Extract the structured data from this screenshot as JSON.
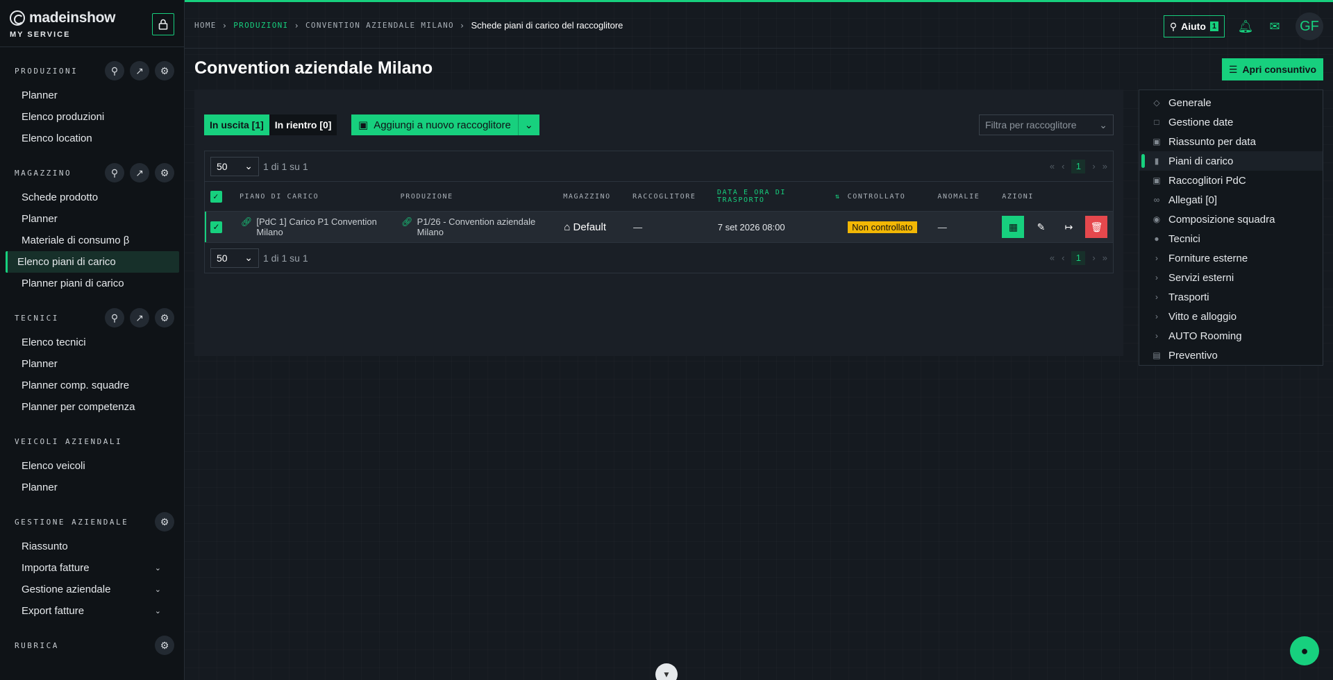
{
  "brand": {
    "name": "madeinshow",
    "sub": "MY SERVICE"
  },
  "sidebar": {
    "sections": [
      {
        "title": "PRODUZIONI",
        "items": [
          "Planner",
          "Elenco produzioni",
          "Elenco location"
        ]
      },
      {
        "title": "MAGAZZINO",
        "items": [
          "Schede prodotto",
          "Planner",
          "Materiale di consumo β",
          "Elenco piani di carico",
          "Planner piani di carico"
        ]
      },
      {
        "title": "TECNICI",
        "items": [
          "Elenco tecnici",
          "Planner",
          "Planner comp. squadre",
          "Planner per competenza"
        ]
      },
      {
        "title": "VEICOLI AZIENDALI",
        "items": [
          "Elenco veicoli",
          "Planner"
        ]
      },
      {
        "title": "GESTIONE AZIENDALE",
        "items": [
          "Riassunto",
          "Importa fatture",
          "Gestione aziendale",
          "Export fatture"
        ]
      },
      {
        "title": "RUBRICA",
        "items": []
      }
    ]
  },
  "breadcrumb": {
    "home": "HOME",
    "produzioni": "PRODUZIONI",
    "convention": "CONVENTION AZIENDALE MILANO",
    "current": "Schede piani di carico del raccoglitore"
  },
  "topbar": {
    "help_label": "Aiuto",
    "help_count": "1",
    "avatar": "GF"
  },
  "page": {
    "title": "Convention aziendale Milano",
    "open_button": "Apri consuntivo"
  },
  "toolbar": {
    "tab_out": "In uscita [1]",
    "tab_in": "In rientro [0]",
    "add_button": "Aggiungi a nuovo raccoglitore",
    "filter_placeholder": "Filtra per raccoglitore"
  },
  "pager": {
    "per_page": "50",
    "summary": "1 di 1 su 1",
    "page": "1"
  },
  "table": {
    "headers": {
      "piano": "PIANO DI CARICO",
      "produzione": "PRODUZIONE",
      "magazzino": "MAGAZZINO",
      "raccoglitore": "RACCOGLITORE",
      "data": "DATA E ORA DI TRASPORTO",
      "controllato": "CONTROLLATO",
      "anomalie": "ANOMALIE",
      "azioni": "AZIONI"
    },
    "rows": [
      {
        "piano": "[PdC 1] Carico P1 Convention Milano",
        "produzione": "P1/26 - Convention aziendale Milano",
        "magazzino": "Default",
        "raccoglitore": "—",
        "data": "7 set 2026 08:00",
        "controllato": "Non controllato",
        "anomalie": "—"
      }
    ]
  },
  "right_menu": [
    {
      "label": "Generale",
      "icon": "tag-icon"
    },
    {
      "label": "Gestione date",
      "icon": "calendar-icon"
    },
    {
      "label": "Riassunto per data",
      "icon": "calendar-check-icon"
    },
    {
      "label": "Piani di carico",
      "icon": "clipboard-icon"
    },
    {
      "label": "Raccoglitori PdC",
      "icon": "archive-icon"
    },
    {
      "label": "Allegati [0]",
      "icon": "paperclip-icon"
    },
    {
      "label": "Composizione squadra",
      "icon": "team-icon"
    },
    {
      "label": "Tecnici",
      "icon": "person-icon"
    },
    {
      "label": "Forniture esterne",
      "icon": "chevron-right-icon"
    },
    {
      "label": "Servizi esterni",
      "icon": "chevron-right-icon"
    },
    {
      "label": "Trasporti",
      "icon": "chevron-right-icon"
    },
    {
      "label": "Vitto e alloggio",
      "icon": "chevron-right-icon"
    },
    {
      "label": "AUTO Rooming",
      "icon": "chevron-right-icon"
    },
    {
      "label": "Preventivo",
      "icon": "document-icon"
    }
  ],
  "colors": {
    "accent": "#17d07e",
    "warning": "#f2b705",
    "danger": "#e5484d"
  }
}
